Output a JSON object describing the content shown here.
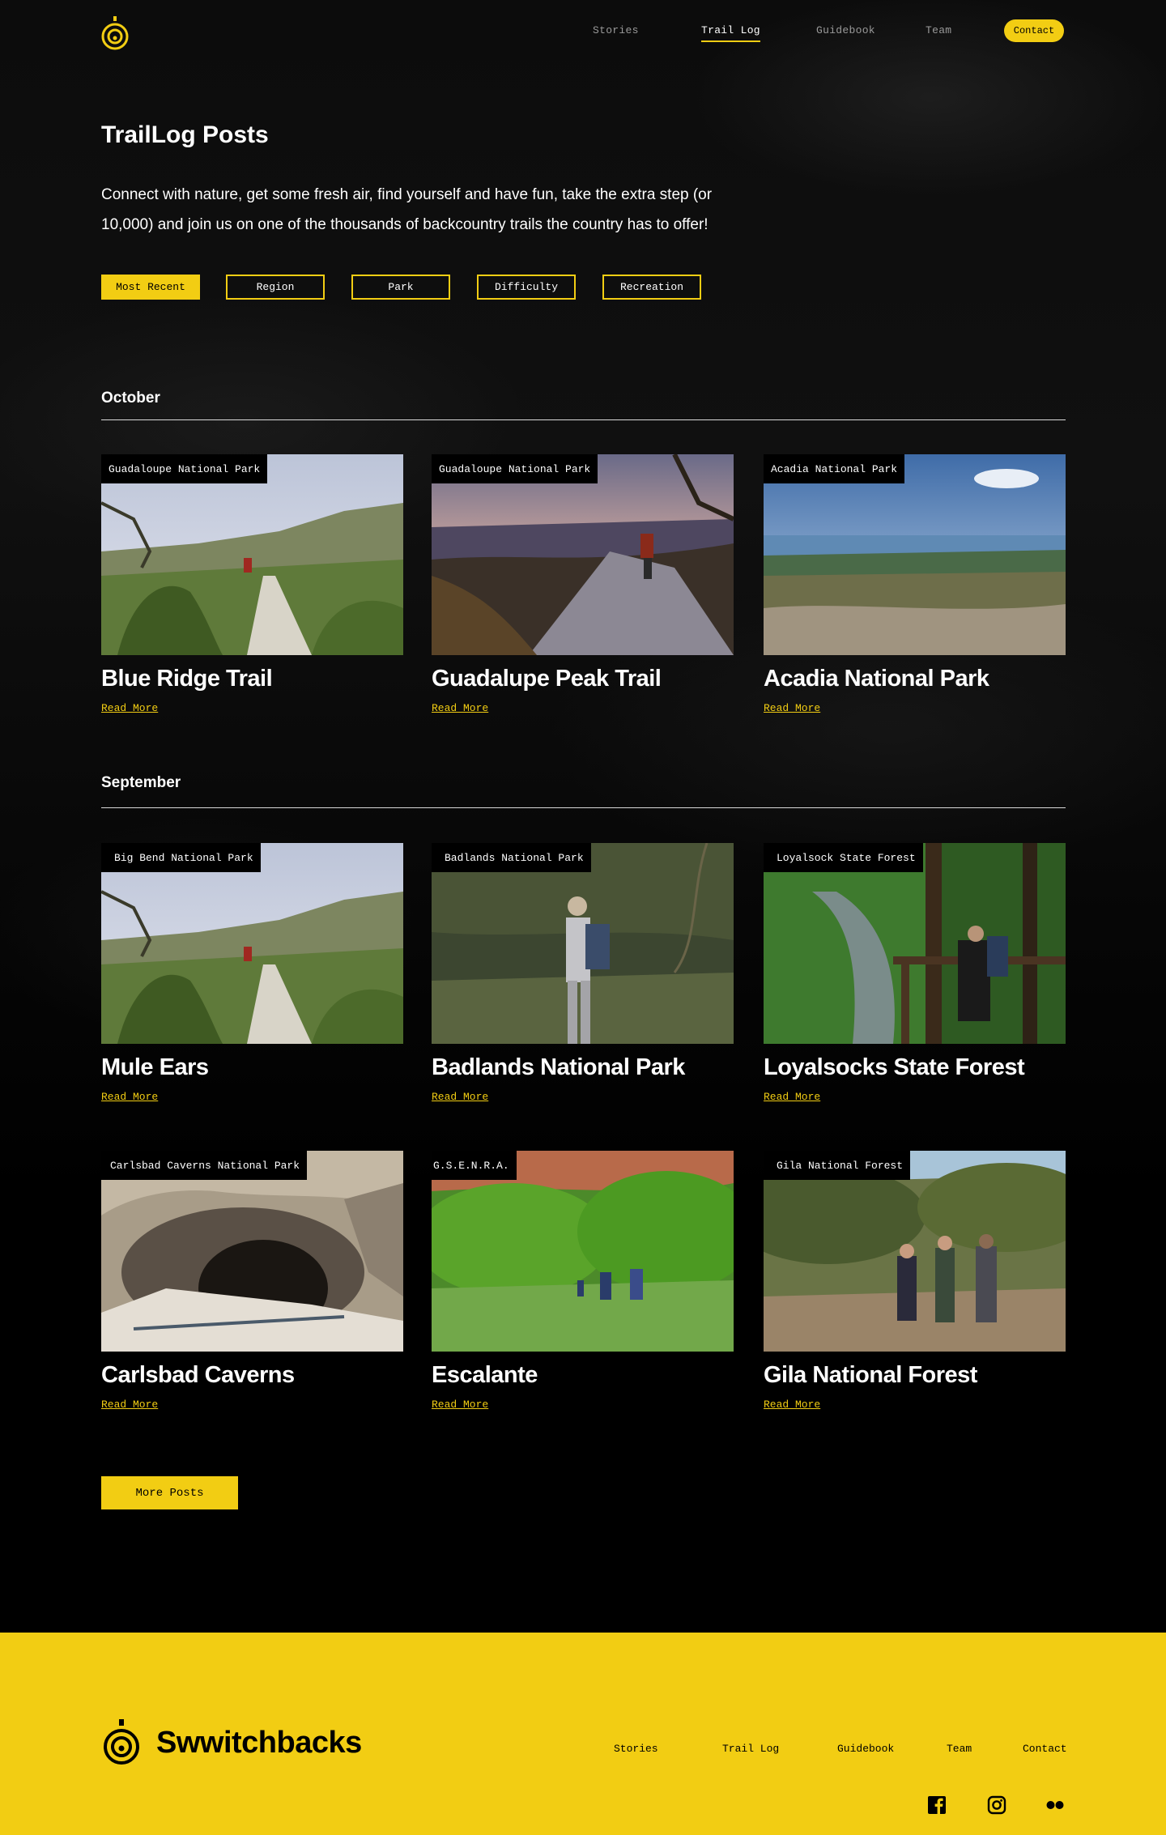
{
  "nav": {
    "logo": "switchbacks-logo-icon",
    "links": [
      {
        "label": "Stories"
      },
      {
        "label": "Trail Log"
      },
      {
        "label": "Guidebook"
      },
      {
        "label": "Team"
      }
    ],
    "contact_label": "Contact"
  },
  "hero": {
    "title": "TrailLog Posts",
    "intro": "Connect with nature, get some fresh air, find yourself and have fun, take the extra step (or 10,000) and join us on one of the thousands of backcountry trails the country has to offer!"
  },
  "filters": [
    {
      "label": "Most Recent"
    },
    {
      "label": "Region"
    },
    {
      "label": "Park"
    },
    {
      "label": "Difficulty"
    },
    {
      "label": "Recreation"
    }
  ],
  "sections": [
    {
      "month": "October"
    },
    {
      "month": "September"
    }
  ],
  "cards": [
    {
      "tag": "Guadaloupe National Park",
      "title": "Blue Ridge Trail",
      "read": "Read More"
    },
    {
      "tag": "Guadaloupe National Park",
      "title": "Guadalupe Peak Trail",
      "read": "Read More"
    },
    {
      "tag": "Acadia National Park",
      "title": "Acadia National Park",
      "read": "Read More"
    },
    {
      "tag": "Big Bend National Park",
      "title": "Mule Ears",
      "read": "Read More"
    },
    {
      "tag": "Badlands National Park",
      "title": "Badlands National Park",
      "read": "Read More"
    },
    {
      "tag": "Loyalsock State Forest",
      "title": "Loyalsocks State Forest",
      "read": "Read More"
    },
    {
      "tag": "Carlsbad Caverns National Park",
      "title": "Carlsbad Caverns",
      "read": "Read More"
    },
    {
      "tag": "G.S.E.N.R.A.",
      "title": "Escalante",
      "read": "Read More"
    },
    {
      "tag": "Gila National Forest",
      "title": "Gila National Forest",
      "read": "Read More"
    }
  ],
  "more_button": "More Posts",
  "footer": {
    "brand": "Swwitchbacks",
    "links": [
      {
        "label": "Stories"
      },
      {
        "label": "Trail Log"
      },
      {
        "label": "Guidebook"
      },
      {
        "label": "Team"
      },
      {
        "label": "Contact"
      }
    ],
    "social": [
      "facebook-icon",
      "instagram-icon",
      "flickr-icon"
    ]
  },
  "colors": {
    "accent": "#f2cd13",
    "background": "#000000",
    "text": "#ffffff"
  }
}
